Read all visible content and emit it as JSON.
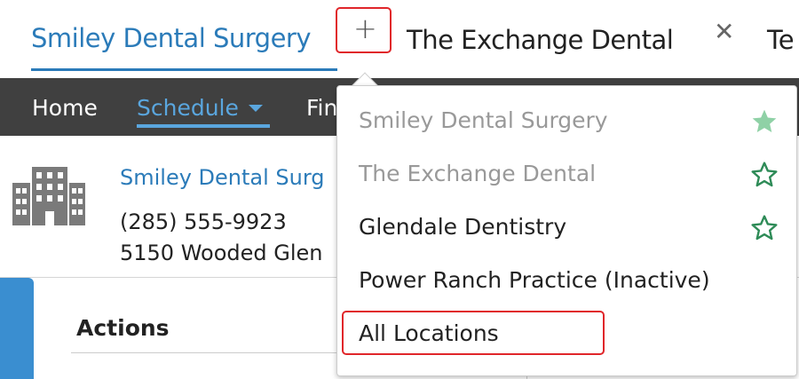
{
  "tabs": {
    "active": "Smiley Dental Surgery",
    "add_glyph": "+",
    "second": "The Exchange Dental",
    "close_glyph": "✕",
    "third_partial": "Te"
  },
  "nav": {
    "home": "Home",
    "schedule": "Schedule",
    "partial": "Fin"
  },
  "practice": {
    "name": "Smiley Dental Surg",
    "phone": "(285) 555-9923",
    "address": "5150 Wooded Glen"
  },
  "actions": {
    "title": "Actions"
  },
  "dropdown": {
    "items": [
      {
        "label": "Smiley Dental Surgery",
        "star": "filled"
      },
      {
        "label": "The Exchange Dental",
        "star": "outline"
      },
      {
        "label": "Glendale Dentistry",
        "star": "outline"
      },
      {
        "label": "Power Ranch Practice (Inactive)",
        "star": "none"
      },
      {
        "label": "All Locations",
        "star": "none"
      }
    ]
  },
  "icons": {
    "building": "building-icon",
    "star_filled": "star-filled-icon",
    "star_outline": "star-outline-icon"
  },
  "colors": {
    "link_blue": "#2b7bb9",
    "nav_blue": "#5aa6de",
    "nav_bg": "#404040",
    "highlight_red": "#e0262a",
    "star_green": "#2e8b57",
    "star_filled_green": "#8fd1a6"
  }
}
